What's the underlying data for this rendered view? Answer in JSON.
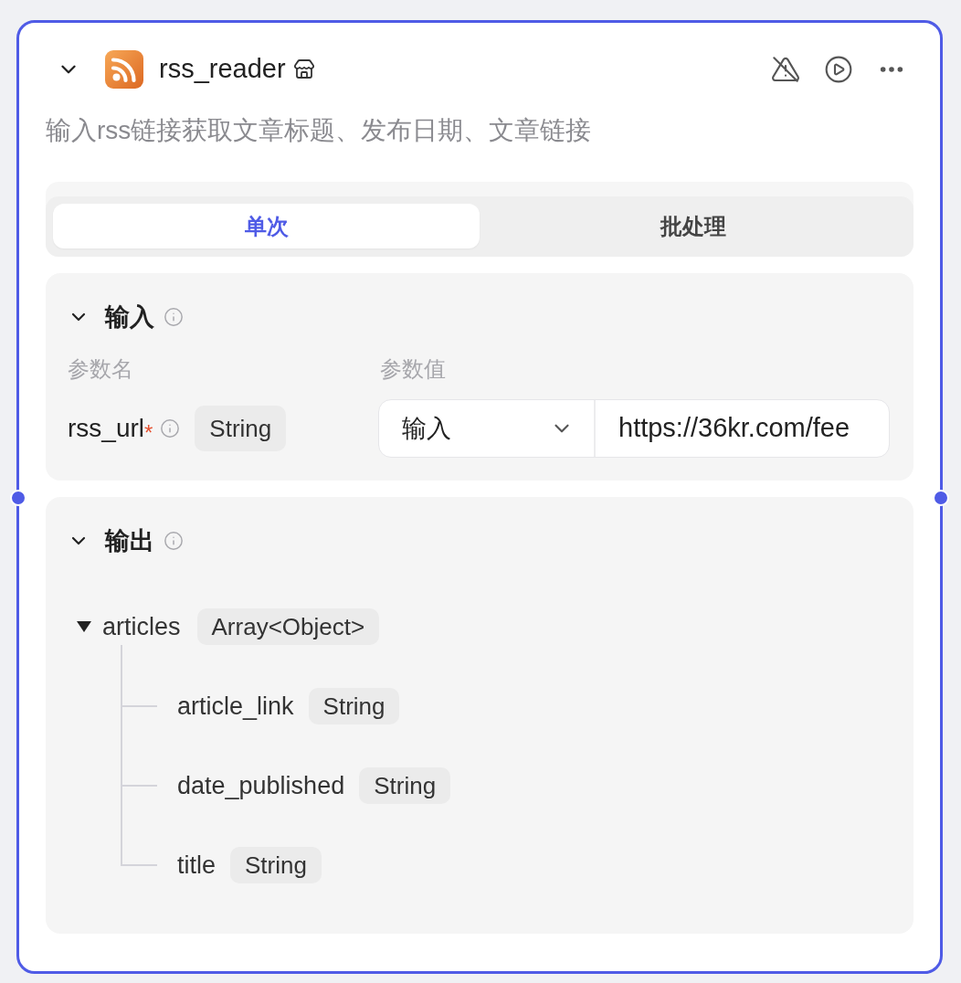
{
  "node": {
    "title": "rss_reader",
    "expanded": true,
    "description": "输入rss链接获取文章标题、发布日期、文章链接"
  },
  "mode_tabs": [
    {
      "label": "单次",
      "selected": true
    },
    {
      "label": "批处理",
      "selected": false
    }
  ],
  "input_section": {
    "title": "输入",
    "expanded": true,
    "columns": [
      "参数名",
      "参数值"
    ],
    "params": [
      {
        "name": "rss_url",
        "required_mark": "*",
        "type": "String",
        "source": "输入",
        "value": "https://36kr.com/fee"
      }
    ]
  },
  "output_section": {
    "title": "输出",
    "expanded": true,
    "fields": [
      {
        "name": "articles",
        "type": "Array<Object>",
        "expanded": true,
        "children": [
          {
            "name": "article_link",
            "type": "String"
          },
          {
            "name": "date_published",
            "type": "String"
          },
          {
            "name": "title",
            "type": "String"
          }
        ]
      }
    ]
  }
}
